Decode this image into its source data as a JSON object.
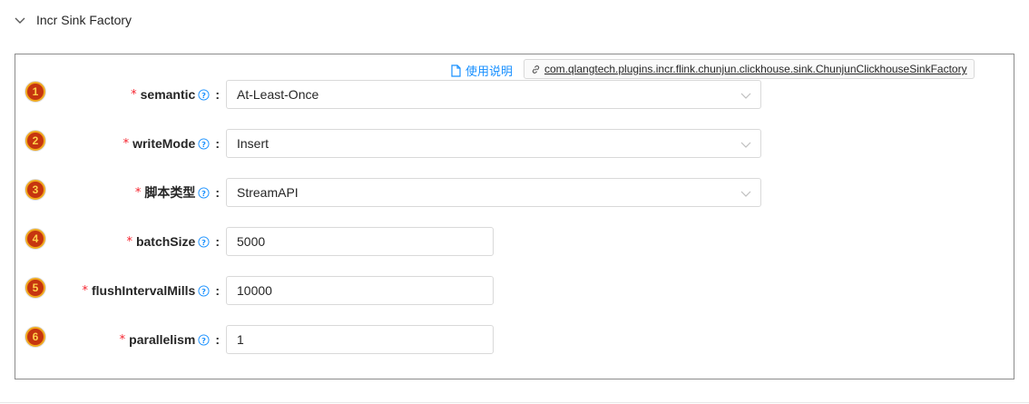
{
  "panel": {
    "title": "Incr Sink Factory"
  },
  "header_links": {
    "doc_label": "使用说明",
    "plugin_class": "com.qlangtech.plugins.incr.flink.chunjun.clickhouse.sink.ChunjunClickhouseSinkFactory"
  },
  "colors": {
    "accent": "#1890ff",
    "required": "#f5222d",
    "badge_fill": "#c6350f",
    "badge_ring": "#f0a81d",
    "highlight_bar": "#fdd11a",
    "red_marker": "#ff1a1a"
  },
  "fields": [
    {
      "badge": "1",
      "label": "semantic",
      "type": "select",
      "value": "At-Least-Once"
    },
    {
      "badge": "2",
      "label": "writeMode",
      "type": "select",
      "value": "Insert"
    },
    {
      "badge": "3",
      "label": "脚本类型",
      "type": "select",
      "value": "StreamAPI"
    },
    {
      "badge": "4",
      "label": "batchSize",
      "type": "input",
      "value": "5000"
    },
    {
      "badge": "5",
      "label": "flushIntervalMills",
      "type": "input",
      "value": "10000"
    },
    {
      "badge": "6",
      "label": "parallelism",
      "type": "input",
      "value": "1"
    }
  ],
  "icons": {
    "collapse": "chevron-down-icon",
    "doc": "file-icon",
    "link": "link-icon",
    "help": "question-circle-icon",
    "dropdown": "chevron-down-icon"
  }
}
